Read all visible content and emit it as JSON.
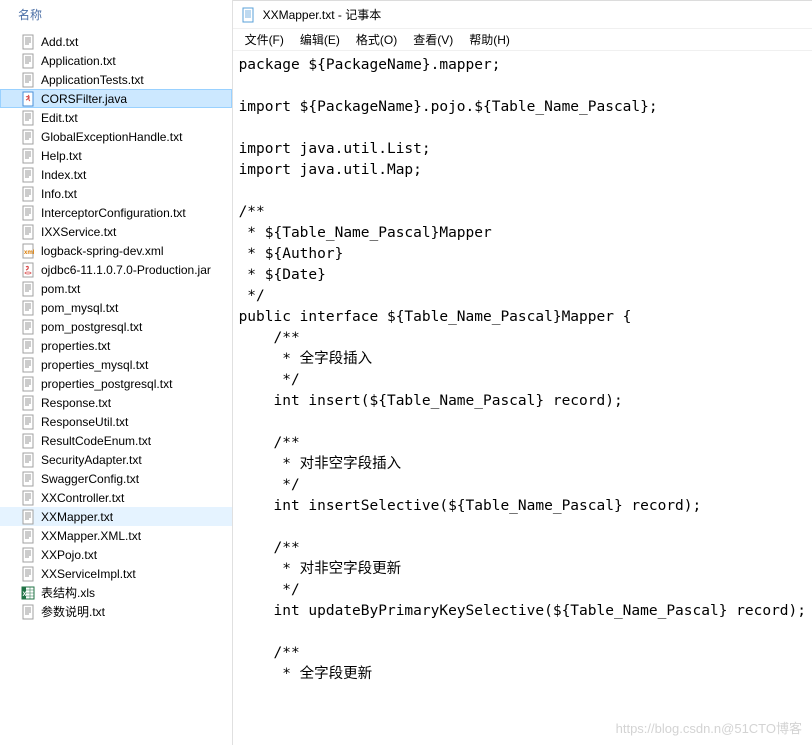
{
  "file_panel": {
    "header": "名称",
    "items": [
      {
        "icon": "txt",
        "label": "Add.txt"
      },
      {
        "icon": "txt",
        "label": "Application.txt"
      },
      {
        "icon": "txt",
        "label": "ApplicationTests.txt"
      },
      {
        "icon": "java",
        "label": "CORSFilter.java",
        "selected": true
      },
      {
        "icon": "txt",
        "label": "Edit.txt"
      },
      {
        "icon": "txt",
        "label": "GlobalExceptionHandle.txt"
      },
      {
        "icon": "txt",
        "label": "Help.txt"
      },
      {
        "icon": "txt",
        "label": "Index.txt"
      },
      {
        "icon": "txt",
        "label": "Info.txt"
      },
      {
        "icon": "txt",
        "label": "InterceptorConfiguration.txt"
      },
      {
        "icon": "txt",
        "label": "IXXService.txt"
      },
      {
        "icon": "xml",
        "label": "logback-spring-dev.xml"
      },
      {
        "icon": "jar",
        "label": "ojdbc6-11.1.0.7.0-Production.jar"
      },
      {
        "icon": "txt",
        "label": "pom.txt"
      },
      {
        "icon": "txt",
        "label": "pom_mysql.txt"
      },
      {
        "icon": "txt",
        "label": "pom_postgresql.txt"
      },
      {
        "icon": "txt",
        "label": "properties.txt"
      },
      {
        "icon": "txt",
        "label": "properties_mysql.txt"
      },
      {
        "icon": "txt",
        "label": "properties_postgresql.txt"
      },
      {
        "icon": "txt",
        "label": "Response.txt"
      },
      {
        "icon": "txt",
        "label": "ResponseUtil.txt"
      },
      {
        "icon": "txt",
        "label": "ResultCodeEnum.txt"
      },
      {
        "icon": "txt",
        "label": "SecurityAdapter.txt"
      },
      {
        "icon": "txt",
        "label": "SwaggerConfig.txt"
      },
      {
        "icon": "txt",
        "label": "XXController.txt"
      },
      {
        "icon": "txt",
        "label": "XXMapper.txt",
        "highlighted": true
      },
      {
        "icon": "txt",
        "label": "XXMapper.XML.txt"
      },
      {
        "icon": "txt",
        "label": "XXPojo.txt"
      },
      {
        "icon": "txt",
        "label": "XXServiceImpl.txt"
      },
      {
        "icon": "xls",
        "label": "表结构.xls"
      },
      {
        "icon": "txt",
        "label": "参数说明.txt"
      }
    ]
  },
  "notepad": {
    "title": "XXMapper.txt - 记事本",
    "menu": [
      "文件(F)",
      "编辑(E)",
      "格式(O)",
      "查看(V)",
      "帮助(H)"
    ],
    "content": "package ${PackageName}.mapper;\n\nimport ${PackageName}.pojo.${Table_Name_Pascal};\n\nimport java.util.List;\nimport java.util.Map;\n\n/**\n * ${Table_Name_Pascal}Mapper\n * ${Author}\n * ${Date}\n */\npublic interface ${Table_Name_Pascal}Mapper {\n    /**\n     * 全字段插入\n     */\n    int insert(${Table_Name_Pascal} record);\n\n    /**\n     * 对非空字段插入\n     */\n    int insertSelective(${Table_Name_Pascal} record);\n\n    /**\n     * 对非空字段更新\n     */\n    int updateByPrimaryKeySelective(${Table_Name_Pascal} record);\n\n    /**\n     * 全字段更新"
  },
  "watermark": "https://blog.csdn.n@51CTO博客"
}
